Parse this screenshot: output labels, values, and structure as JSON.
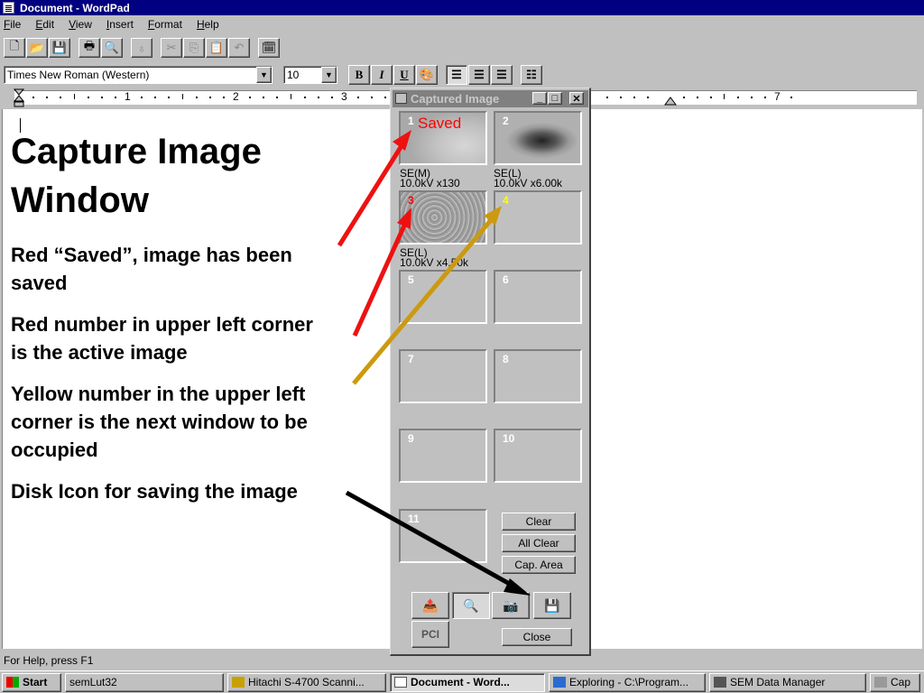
{
  "window": {
    "title": "Document - WordPad"
  },
  "menu": [
    "File",
    "Edit",
    "View",
    "Insert",
    "Format",
    "Help"
  ],
  "toolbar": {
    "icons": [
      "new-icon",
      "open-icon",
      "save-icon",
      "print-icon",
      "print-preview-icon",
      "find-icon",
      "cut-icon",
      "copy-icon",
      "paste-icon",
      "undo-icon",
      "date-time-icon"
    ]
  },
  "format": {
    "font": "Times New Roman (Western)",
    "size": "10",
    "bold_label": "B",
    "italic_label": "I",
    "underline_label": "U"
  },
  "ruler": {
    "numbers": [
      "1",
      "2",
      "3",
      "7"
    ]
  },
  "document": {
    "heading_line1": "Capture Image",
    "heading_line2": "Window",
    "p1_line1": "Red “Saved”, image has been",
    "p1_line2": "saved",
    "p2_line1": "Red number in upper left corner",
    "p2_line2": "is the active image",
    "p3_line1": "Yellow number in the upper left",
    "p3_line2": "corner is the next window to be",
    "p3_line3": "occupied",
    "p4_line1": "Disk Icon for saving the image"
  },
  "status": {
    "text": "For Help, press F1"
  },
  "taskbar": {
    "start": "Start",
    "items": [
      "semLut32",
      "Hitachi S-4700 Scanni...",
      "Document - Word...",
      "Exploring - C:\\Program...",
      "SEM Data Manager",
      "Cap"
    ]
  },
  "capture_window": {
    "title": "Captured Image",
    "saved_label": "Saved",
    "slots": [
      {
        "num": "1",
        "line1": "SE(M)",
        "line2": "10.0kV x130"
      },
      {
        "num": "2",
        "line1": "SE(L)",
        "line2": "10.0kV x6.00k"
      },
      {
        "num": "3",
        "line1": "SE(L)",
        "line2": "10.0kV x4.50k"
      },
      {
        "num": "4"
      },
      {
        "num": "5"
      },
      {
        "num": "6"
      },
      {
        "num": "7"
      },
      {
        "num": "8"
      },
      {
        "num": "9"
      },
      {
        "num": "10"
      },
      {
        "num": "11"
      }
    ],
    "buttons": {
      "clear": "Clear",
      "all_clear": "All Clear",
      "cap_area": "Cap. Area",
      "close": "Close"
    },
    "pci_label": "PCI"
  },
  "colors": {
    "active_number": "#ff0000",
    "next_number": "#ffff00",
    "arrow_red": "#ee1111",
    "arrow_gold": "#cc9a10",
    "arrow_black": "#000000"
  }
}
